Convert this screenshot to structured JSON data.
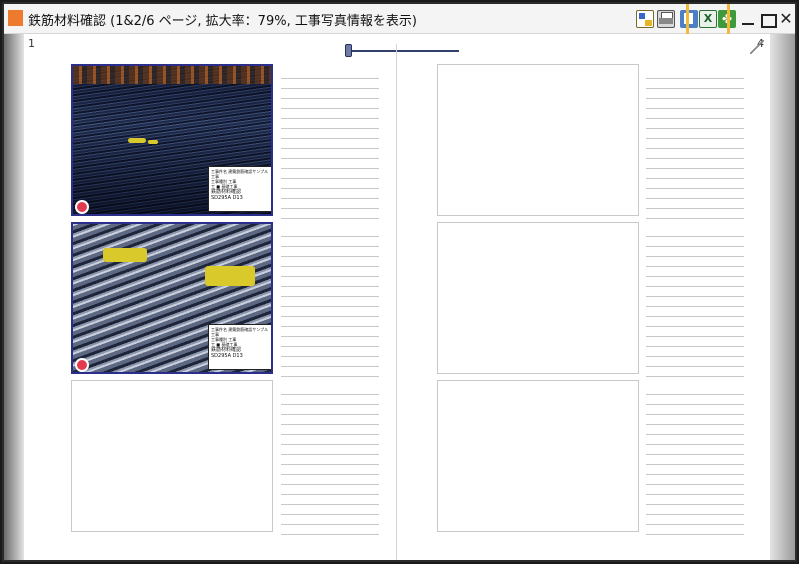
{
  "window": {
    "title": "鉄筋材料確認 (1&2/6 ページ, 拡大率：79%, 工事写真情報を表示)"
  },
  "toolbar": {
    "list_icon": "list-view-icon",
    "print_icon": "printer-icon",
    "export_icon": "export-icon",
    "excel_label": "X",
    "settings_label": "✤"
  },
  "window_controls": {
    "minimize_icon": "minimize-icon",
    "maximize_icon": "maximize-icon",
    "close_label": "✕"
  },
  "viewer": {
    "left_page_number": "1",
    "right_page_number": "4"
  },
  "photos": [
    {
      "board_lines": [
        "工事件名 建築鉄筋確認サンプル工事",
        "工事種別 工事",
        "工 ■ 基礎工事",
        "鉄筋材料確認",
        "SD295A D13"
      ]
    },
    {
      "board_lines": [
        "工事件名 建築鉄筋確認サンプル工事",
        "工事種別 工事",
        "工 ■ 基礎工事",
        "鉄筋材料確認",
        "SD295A D13"
      ]
    }
  ],
  "colors": {
    "accent_orange": "#ee7a2d",
    "highlight": "#f2b83a",
    "photo_border": "#2c2e8c"
  }
}
